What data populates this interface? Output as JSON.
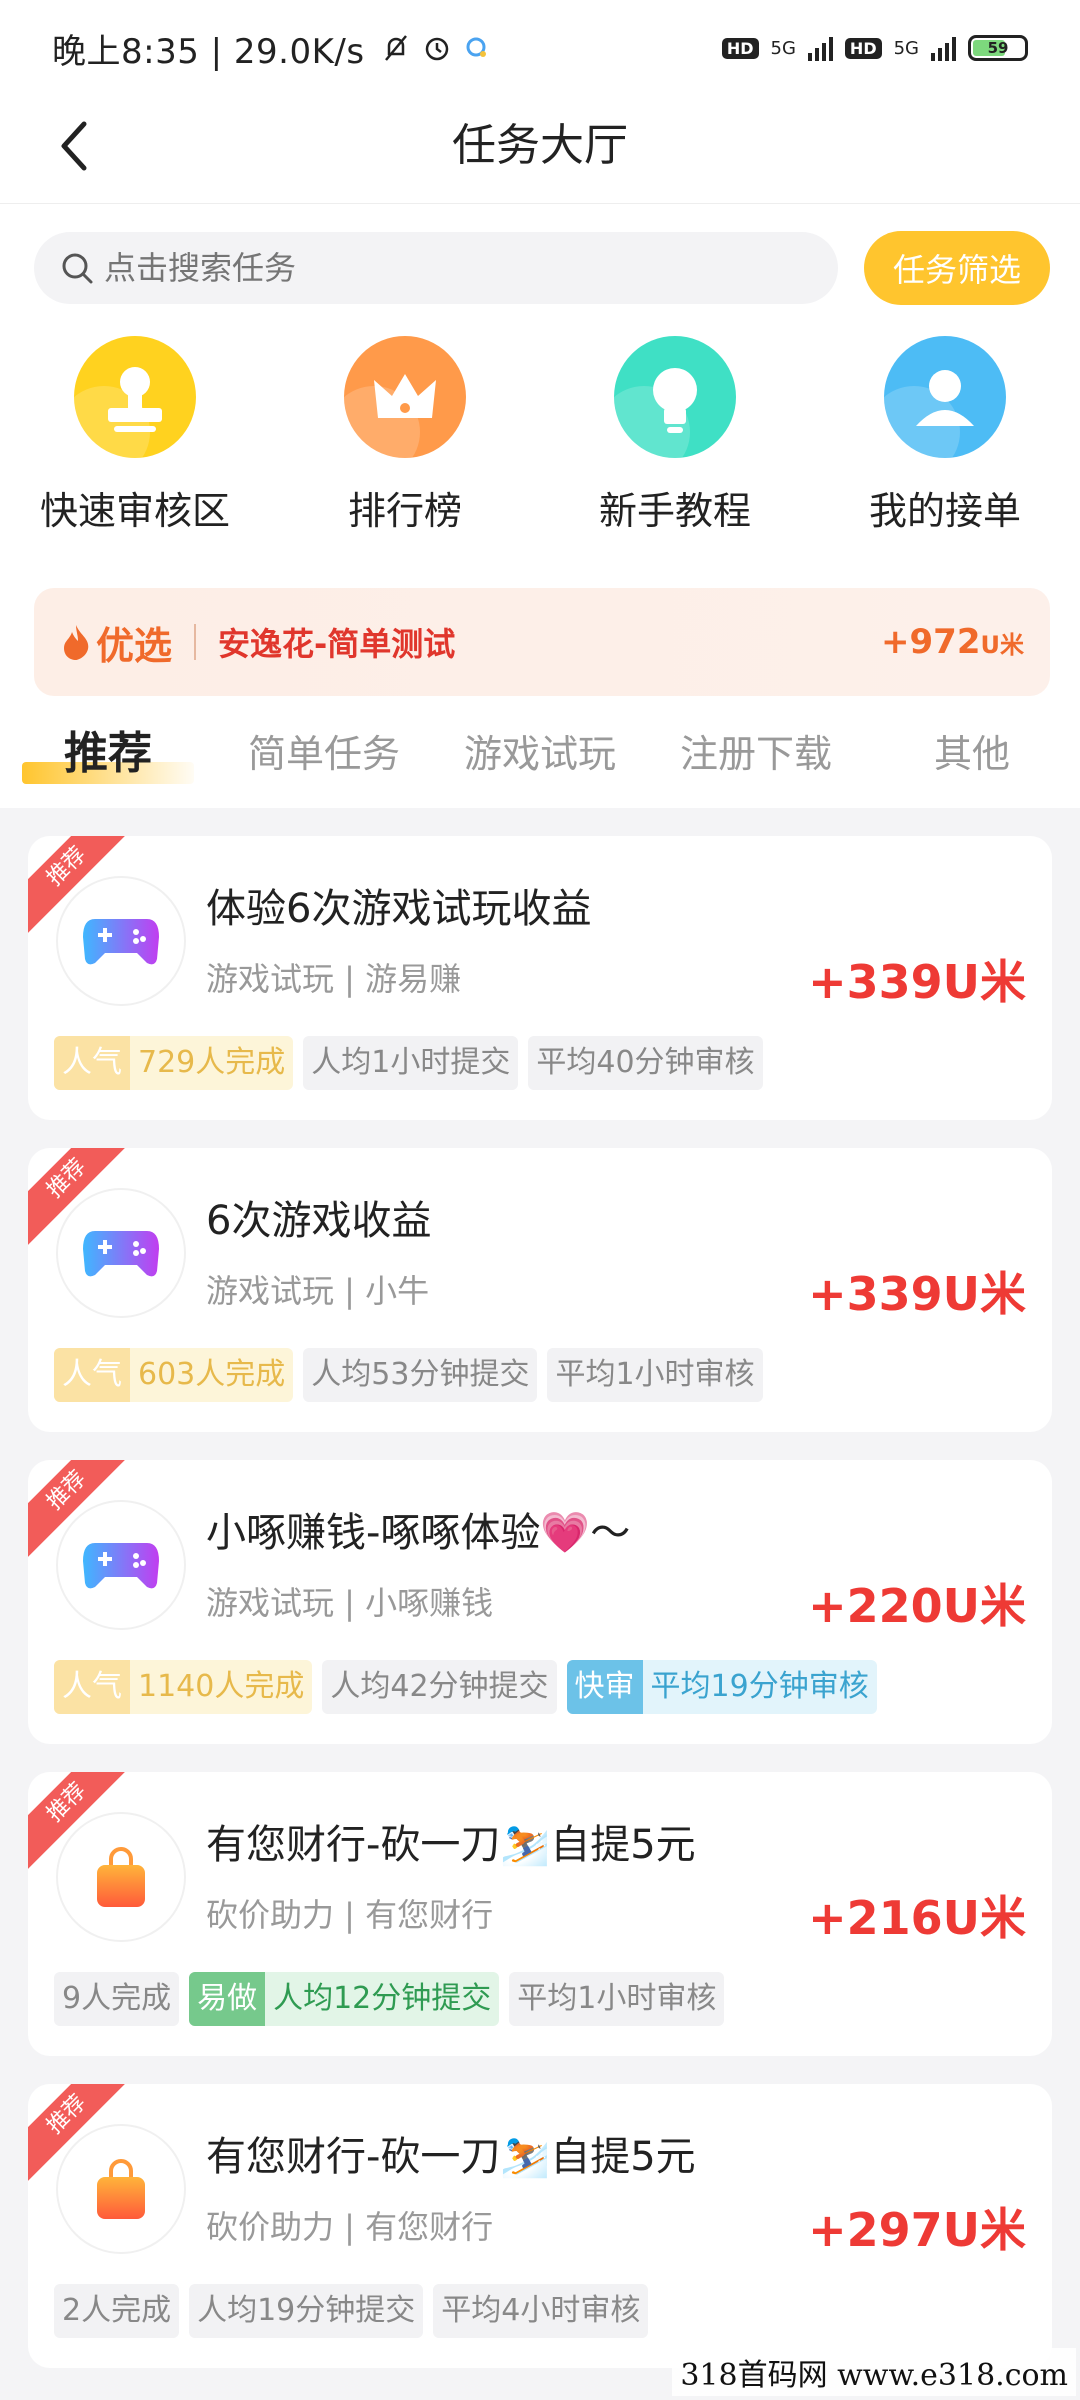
{
  "statusbar": {
    "time": "晚上8:35 | 29.0K/s",
    "battery": "59",
    "net1": "5G",
    "net2": "5G"
  },
  "nav": {
    "title": "任务大厅"
  },
  "search": {
    "placeholder": "点击搜索任务",
    "filter_label": "任务筛选"
  },
  "quicknav": [
    {
      "label": "快速审核区",
      "icon": "stamp-icon",
      "color": "#ffd21f"
    },
    {
      "label": "排行榜",
      "icon": "crown-icon",
      "color": "#ff9a4a"
    },
    {
      "label": "新手教程",
      "icon": "lightbulb-icon",
      "color": "#3fe0c5"
    },
    {
      "label": "我的接单",
      "icon": "user-icon",
      "color": "#4dbcf5"
    }
  ],
  "banner": {
    "badge": "优选",
    "title": "安逸花-简单测试",
    "reward": "+972",
    "unit": "U米"
  },
  "tabs": [
    "推荐",
    "简单任务",
    "游戏试玩",
    "注册下载",
    "其他"
  ],
  "tasks": [
    {
      "ribbon": "推荐",
      "icon": "gamepad-icon",
      "title": "体验6次游戏试玩收益",
      "sub": "游戏试玩 | 游易赚",
      "reward": "+339U米",
      "tags": [
        {
          "type": "pop",
          "k": "人气",
          "v": "729人完成"
        },
        {
          "type": "plain",
          "v": "人均1小时提交"
        },
        {
          "type": "plain",
          "v": "平均40分钟审核"
        }
      ]
    },
    {
      "ribbon": "推荐",
      "icon": "gamepad-icon",
      "title": "6次游戏收益",
      "sub": "游戏试玩 | 小牛",
      "reward": "+339U米",
      "tags": [
        {
          "type": "pop",
          "k": "人气",
          "v": "603人完成"
        },
        {
          "type": "plain",
          "v": "人均53分钟提交"
        },
        {
          "type": "plain",
          "v": "平均1小时审核"
        }
      ]
    },
    {
      "ribbon": "推荐",
      "icon": "gamepad-icon",
      "title": "小啄赚钱-啄啄体验💗～",
      "sub": "游戏试玩 | 小啄赚钱",
      "reward": "+220U米",
      "tags": [
        {
          "type": "pop",
          "k": "人气",
          "v": "1140人完成"
        },
        {
          "type": "plain",
          "v": "人均42分钟提交"
        },
        {
          "type": "fast",
          "k": "快审",
          "v": "平均19分钟审核"
        }
      ]
    },
    {
      "ribbon": "推荐",
      "icon": "shopping-bag-icon",
      "title": "有您财行-砍一刀⛷️自提5元",
      "sub": "砍价助力 | 有您财行",
      "reward": "+216U米",
      "tags": [
        {
          "type": "plain",
          "v": "9人完成"
        },
        {
          "type": "easy",
          "k": "易做",
          "v": "人均12分钟提交"
        },
        {
          "type": "plain",
          "v": "平均1小时审核"
        }
      ]
    },
    {
      "ribbon": "推荐",
      "icon": "shopping-bag-icon",
      "title": "有您财行-砍一刀⛷️自提5元",
      "sub": "砍价助力 | 有您财行",
      "reward": "+297U米",
      "tags": [
        {
          "type": "plain",
          "v": "2人完成"
        },
        {
          "type": "plain",
          "v": "人均19分钟提交"
        },
        {
          "type": "plain",
          "v": "平均4小时审核"
        }
      ]
    }
  ],
  "watermark": "318首码网  www.e318.com"
}
